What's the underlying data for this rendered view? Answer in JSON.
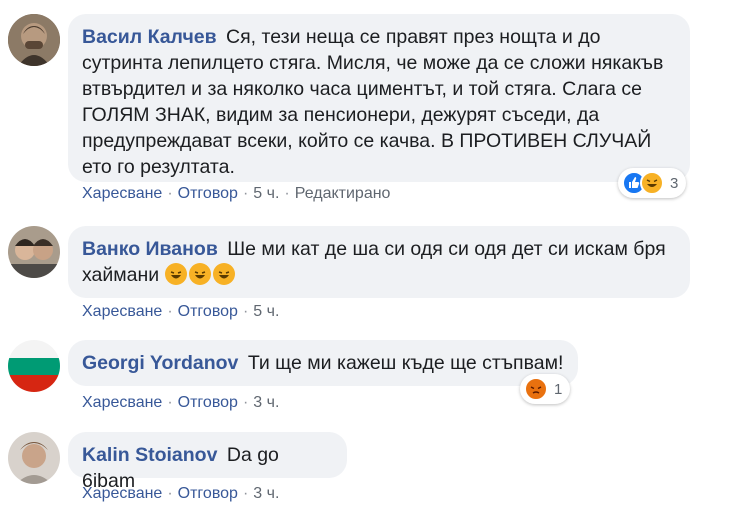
{
  "colors": {
    "author": "#385898",
    "bubble_bg": "#f0f2f5",
    "meta_text": "#606770",
    "like_blue": "#1877f2",
    "haha_yellow": "#f7b125",
    "angry_orange": "#e9710f"
  },
  "comments": [
    {
      "author": "Васил Калчев",
      "text_lines": [
        "Ся, тези неща се правят през нощта и до",
        "сутринта лепилцето стяга. Мисля, че може да се сложи някакъв",
        "втвърдител и за няколко часа циментът, и той стяга. Слага се",
        "ГОЛЯМ ЗНАК, видим за пенсионери, дежурят съседи, да",
        "предупреждават всеки, който се качва. В ПРОТИВЕН СЛУЧАЙ",
        "ето го резултата."
      ],
      "actions": {
        "like": "Харесване",
        "reply": "Отговор",
        "time": "5 ч.",
        "edited": "Редактирано"
      },
      "reactions": {
        "icons": [
          "like-icon",
          "haha-icon"
        ],
        "count": "3"
      }
    },
    {
      "author": "Ванко Иванов",
      "text_lines": [
        "Ше ми кат де ша си одя си одя дет си искам бря",
        "хаймани"
      ],
      "emoji": [
        "rofl-emoji",
        "rofl-emoji",
        "rofl-emoji"
      ],
      "actions": {
        "like": "Харесване",
        "reply": "Отговор",
        "time": "5 ч."
      }
    },
    {
      "author": "Georgi Yordanov",
      "text": "Ти ще ми кажеш къде ще стъпвам!",
      "actions": {
        "like": "Харесване",
        "reply": "Отговор",
        "time": "3 ч."
      },
      "reactions": {
        "icons": [
          "angry-icon"
        ],
        "count": "1"
      }
    },
    {
      "author": "Kalin Stoianov",
      "text": "Da go 6ibam",
      "actions": {
        "like": "Харесване",
        "reply": "Отговор",
        "time": "3 ч."
      }
    }
  ]
}
